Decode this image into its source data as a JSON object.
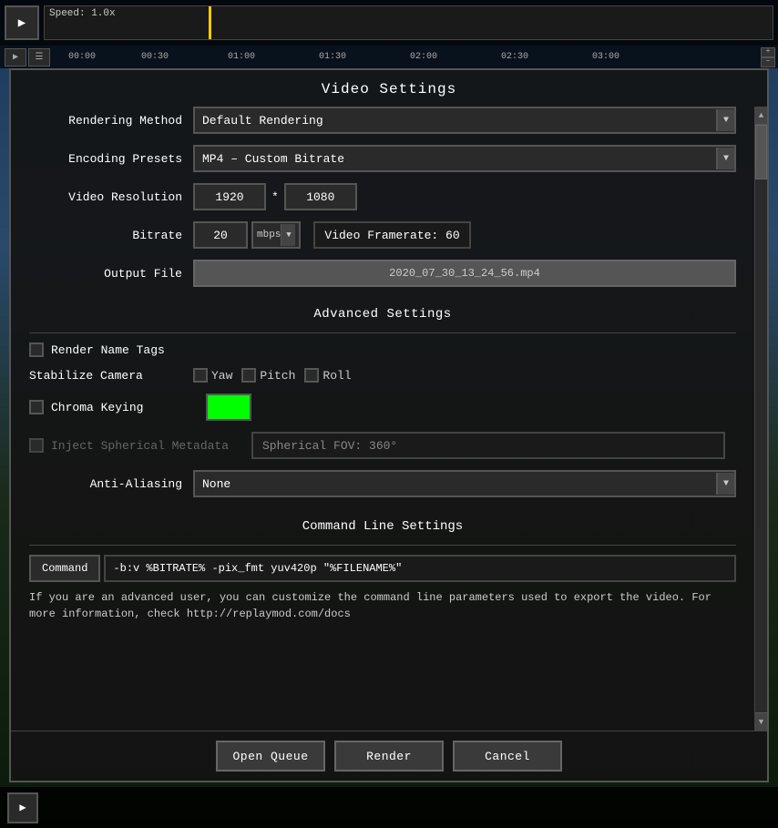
{
  "top_bar": {
    "speed_label": "Speed: 1.0x"
  },
  "timeline_ruler": {
    "ticks": [
      "00:00",
      "00:30",
      "01:00",
      "01:30",
      "02:00",
      "02:30",
      "03:00"
    ]
  },
  "dialog": {
    "title": "Video Settings",
    "rendering_method": {
      "label": "Rendering Method",
      "value": "Default Rendering"
    },
    "encoding_presets": {
      "label": "Encoding Presets",
      "value": "MP4 – Custom Bitrate"
    },
    "video_resolution": {
      "label": "Video Resolution",
      "width": "1920",
      "height": "1080",
      "separator": "*"
    },
    "bitrate": {
      "label": "Bitrate",
      "value": "20",
      "unit": "mbps",
      "framerate_label": "Video Framerate: 60"
    },
    "output_file": {
      "label": "Output File",
      "value": "2020_07_30_13_24_56.mp4"
    },
    "advanced_settings_title": "Advanced Settings",
    "render_name_tags": {
      "label": "Render Name Tags",
      "checked": false
    },
    "stabilize_camera": {
      "label": "Stabilize Camera",
      "yaw_label": "Yaw",
      "pitch_label": "Pitch",
      "roll_label": "Roll",
      "yaw_checked": false,
      "pitch_checked": false,
      "roll_checked": false
    },
    "chroma_keying": {
      "label": "Chroma Keying",
      "color": "#00ff00"
    },
    "inject_spherical": {
      "label": "Inject Spherical Metadata",
      "fov_label": "Spherical FOV: 360°",
      "checked": false,
      "disabled": true
    },
    "anti_aliasing": {
      "label": "Anti-Aliasing",
      "value": "None"
    },
    "command_line_title": "Command Line Settings",
    "command_btn_label": "Command",
    "command_value": "-b:v %BITRATE% -pix_fmt yuv420p \"%FILENAME%\"",
    "command_help": "If you are an advanced user, you can customize the command line parameters used to export the video. For more information, check http://replaymod.com/docs",
    "open_queue_label": "Open Queue",
    "render_label": "Render",
    "cancel_label": "Cancel"
  }
}
